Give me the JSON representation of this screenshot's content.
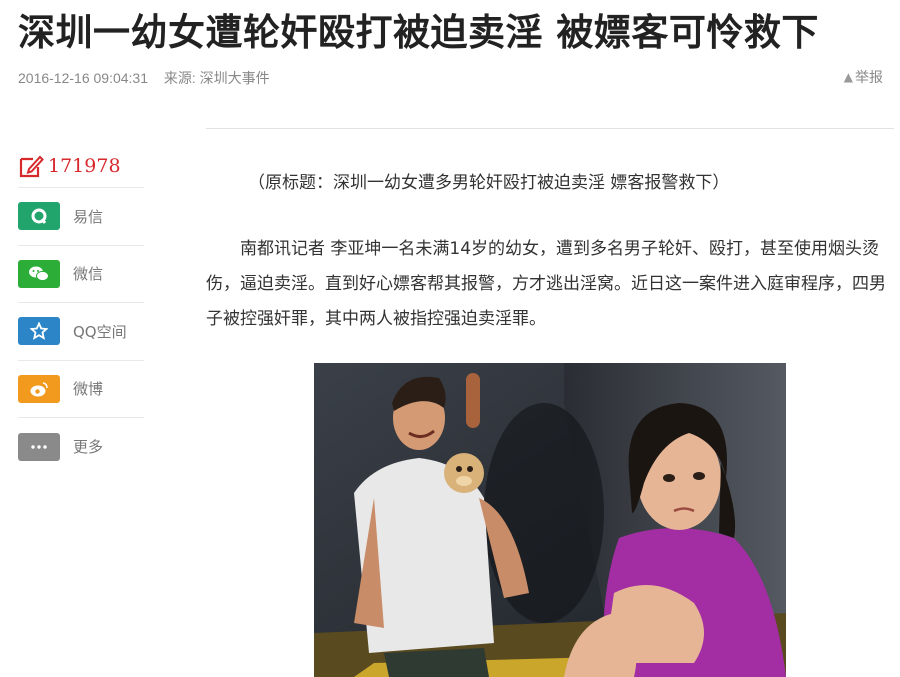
{
  "article": {
    "title": "深圳一幼女遭轮奸殴打被迫卖淫 被嫖客可怜救下",
    "date": "2016-12-16 09:04:31",
    "source": "来源: 深圳大事件",
    "report_label": "举报",
    "subtitle": "（原标题：深圳一幼女遭多男轮奸殴打被迫卖淫 嫖客报警救下）",
    "paragraph": "南都讯记者 李亚坤一名未满14岁的幼女，遭到多名男子轮奸、殴打，甚至使用烟头烫伤，逼迫卖淫。直到好心嫖客帮其报警，方才逃出淫窝。近日这一案件进入庭审程序，四男子被控强奸罪，其中两人被指控强迫卖淫罪。"
  },
  "comments": {
    "count": "171978",
    "color": "#d7282c"
  },
  "share": {
    "items": [
      {
        "label": "易信",
        "icon": "yixin-icon",
        "color": "#22a56c"
      },
      {
        "label": "微信",
        "icon": "wechat-icon",
        "color": "#2bad37"
      },
      {
        "label": "QQ空间",
        "icon": "qzone-icon",
        "color": "#2b85c6"
      },
      {
        "label": "微博",
        "icon": "weibo-icon",
        "color": "#f29a1e"
      },
      {
        "label": "更多",
        "icon": "more-icon",
        "color": "#8a8a8a"
      }
    ]
  }
}
